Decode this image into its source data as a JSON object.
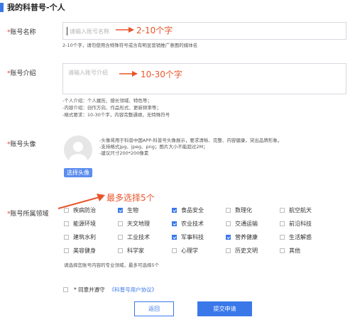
{
  "title": "我的科普号-个人",
  "account_name": {
    "label": "账号名称",
    "placeholder": "请输入账号名称",
    "annotation": "2-10个字",
    "hint": "2-10个字，请勿使用含特殊符号或含有明显营销推广意图的媒体名"
  },
  "account_intro": {
    "label": "账号介绍",
    "placeholder": "请输入账号介绍",
    "annotation": "10-30个字",
    "hints": [
      "-个人介绍：个人履历、擅长领域、特色等；",
      "-内容介绍：创作方向、作品形式、更新频率等；",
      "-格式要求：10-30个字，内容完整通顺，无特殊符号"
    ]
  },
  "avatar": {
    "label": "账号头像",
    "hints": [
      "-头像将用于科普中国APP-科普号头像展示，要求清晰、完整、内容健康，突出品牌形象。",
      "-支持格式jpg、jpeg、png；图片大小不能超过2M；",
      "-建议尺寸200*200像素"
    ],
    "button": "选择头像"
  },
  "domain": {
    "label": "账号所属领域",
    "annotation": "最多选择5个",
    "hint": "请选择您账号内容的专业领域，最多可选择5个",
    "options": [
      {
        "label": "疾病防治",
        "checked": false
      },
      {
        "label": "生物",
        "checked": true
      },
      {
        "label": "食品安全",
        "checked": true
      },
      {
        "label": "数理化",
        "checked": false
      },
      {
        "label": "航空航天",
        "checked": false
      },
      {
        "label": "能源环境",
        "checked": false
      },
      {
        "label": "天文地理",
        "checked": false
      },
      {
        "label": "农业技术",
        "checked": true
      },
      {
        "label": "交通运输",
        "checked": false
      },
      {
        "label": "前沿科技",
        "checked": false
      },
      {
        "label": "建筑水利",
        "checked": false
      },
      {
        "label": "工业技术",
        "checked": false
      },
      {
        "label": "军事科技",
        "checked": true
      },
      {
        "label": "营养健康",
        "checked": true
      },
      {
        "label": "生活解惑",
        "checked": false
      },
      {
        "label": "美容健身",
        "checked": false
      },
      {
        "label": "科学家",
        "checked": false
      },
      {
        "label": "心理学",
        "checked": false
      },
      {
        "label": "历史文明",
        "checked": false
      },
      {
        "label": "其他",
        "checked": false
      }
    ]
  },
  "agreement": {
    "prefix": "* 同意并遵守",
    "link": "《科普号用户协议》"
  },
  "buttons": {
    "back": "返回",
    "submit": "提交申请"
  },
  "colors": {
    "accent": "#3a78ea",
    "annotation": "#e8552b",
    "required": "#e53935"
  }
}
